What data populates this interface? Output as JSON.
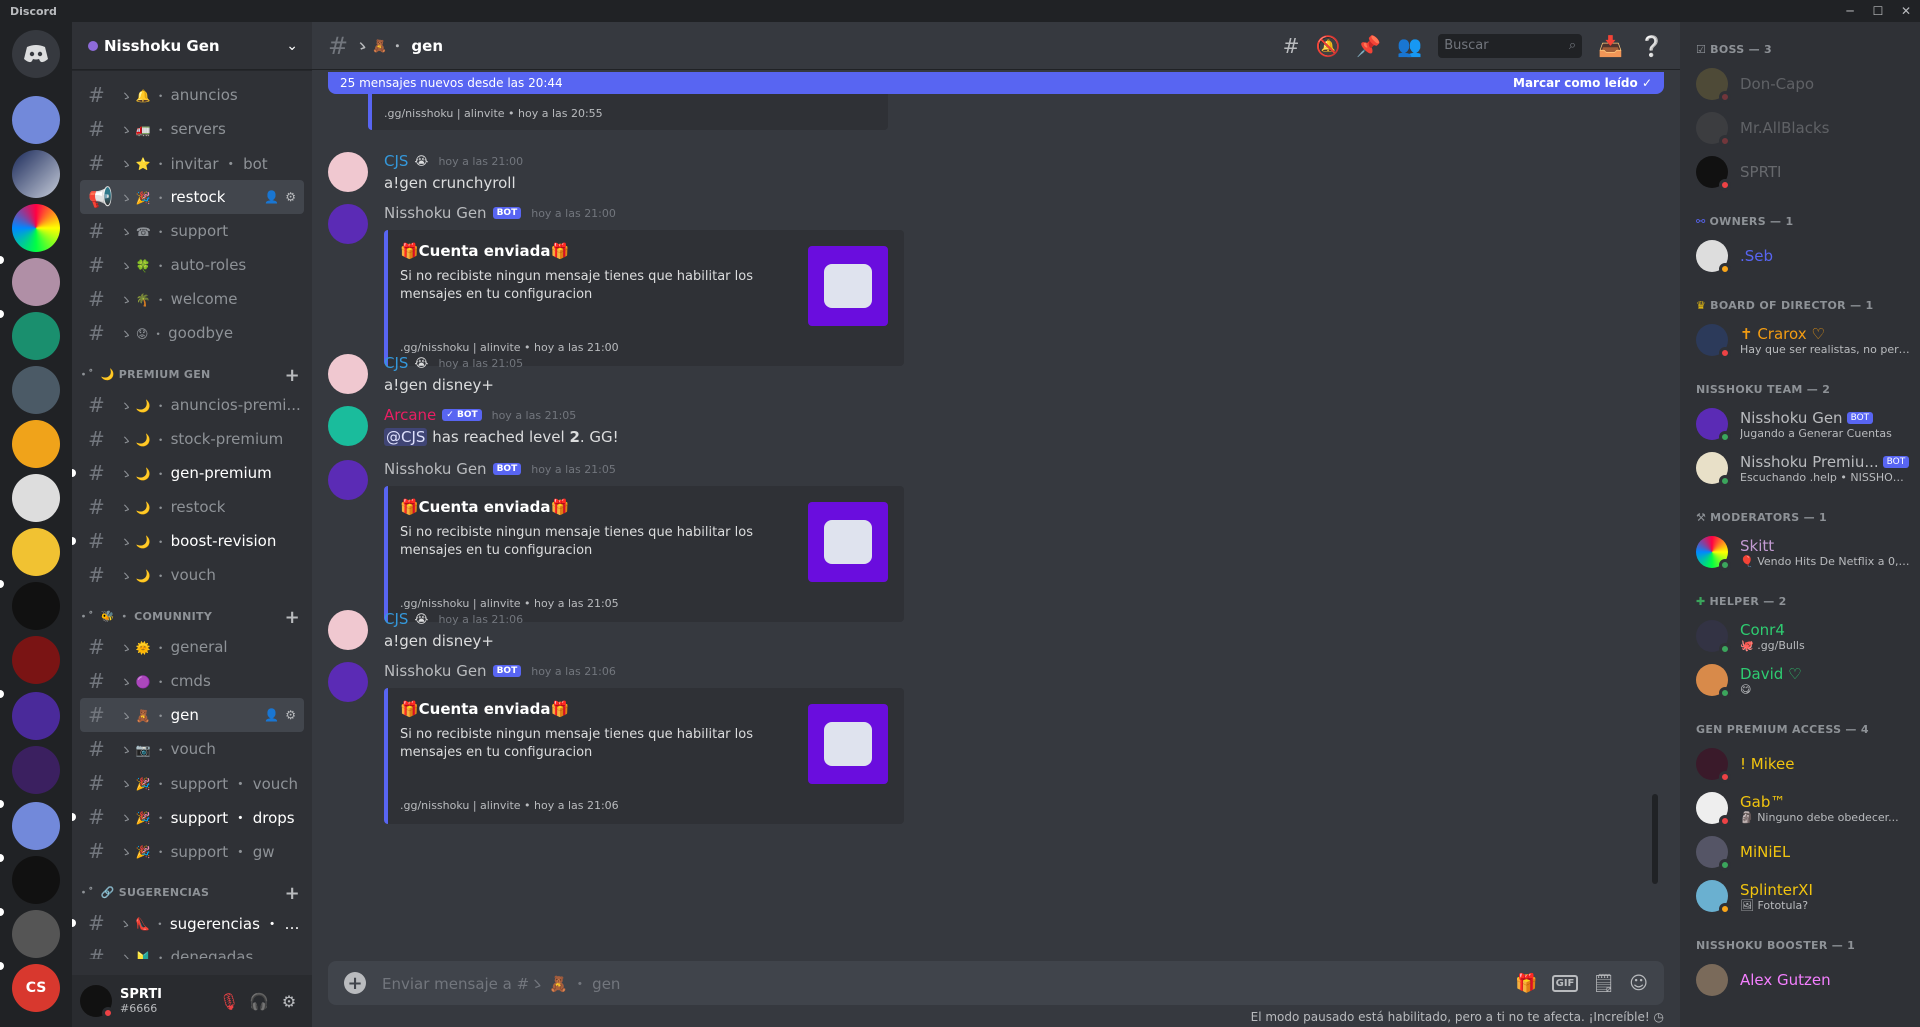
{
  "window": {
    "app_name": "Discord"
  },
  "server": {
    "name": "Nisshoku Gen"
  },
  "channels": [
    {
      "prefix": "ゝ 🔔 ・",
      "name": "anuncios"
    },
    {
      "prefix": "ゝ 🚛 ・",
      "name": "servers"
    },
    {
      "prefix": "ゝ ⭐ ・",
      "name": "invitar ・ bot"
    },
    {
      "prefix": "ゝ 🎉 ・",
      "name": "restock"
    },
    {
      "prefix": "ゝ ☎ ・",
      "name": "support"
    },
    {
      "prefix": "ゝ 🍀 ・",
      "name": "auto-roles"
    },
    {
      "prefix": "ゝ 🌴 ・",
      "name": "welcome"
    },
    {
      "prefix": "ゝ 😟 ・",
      "name": "goodbye"
    }
  ],
  "category_premium": {
    "label": "・゜🌙 PREMIUM GEN"
  },
  "channels_premium": [
    {
      "prefix": "ゝ 🌙 ・",
      "name": "anuncios-premi..."
    },
    {
      "prefix": "ゝ 🌙 ・",
      "name": "stock-premium"
    },
    {
      "prefix": "ゝ 🌙 ・",
      "name": "gen-premium"
    },
    {
      "prefix": "ゝ 🌙 ・",
      "name": "restock"
    },
    {
      "prefix": "ゝ 🌙 ・",
      "name": "boost-revision"
    },
    {
      "prefix": "ゝ 🌙 ・",
      "name": "vouch"
    }
  ],
  "category_community": {
    "label": "・゜🐝 ・ COMUNNITY"
  },
  "channels_community": [
    {
      "prefix": "ゝ 🌞 ・",
      "name": "general"
    },
    {
      "prefix": "ゝ 🟣 ・",
      "name": "cmds"
    },
    {
      "prefix": "ゝ 🧸 ・",
      "name": "gen"
    },
    {
      "prefix": "ゝ 📷 ・",
      "name": "vouch"
    },
    {
      "prefix": "ゝ 🎉 ・",
      "name": "support ・ vouch"
    },
    {
      "prefix": "ゝ 🎉 ・",
      "name": "support ・ drops"
    },
    {
      "prefix": "ゝ 🎉 ・",
      "name": "support ・ gw"
    }
  ],
  "category_sugerencias": {
    "label": "・゜🔗 SUGERENCIAS"
  },
  "channels_sugerencias": [
    {
      "prefix": "ゝ 👠 ・",
      "name": "sugerencias ・ b..."
    },
    {
      "prefix": "ゝ 🔰 ・",
      "name": "denegadas"
    }
  ],
  "user": {
    "name": "SPRTI",
    "tag": "#6666"
  },
  "chat": {
    "channel_prefix": "ゝ 🧸 ・",
    "channel_name": "gen",
    "search_placeholder": "Buscar",
    "new_messages": "25 mensajes nuevos desde las 20:44",
    "mark_read": "Marcar como leído",
    "composer_placeholder": "Enviar mensaje a #ゝ 🧸 ・ gen",
    "gif_label": "GIF",
    "pause_notice": "El modo pausado está habilitado, pero a ti no te afecta. ¡Increíble!"
  },
  "prev_embed_footer": ".gg/nisshoku | alinvite • hoy a las 20:55",
  "messages": [
    {
      "author": "CJS",
      "time": "hoy a las 21:00",
      "text": "a!gen crunchyroll"
    },
    {
      "author": "Nisshoku Gen",
      "badge": "BOT",
      "time": "hoy a las 21:00",
      "embed_title": "🎁Cuenta enviada🎁",
      "embed_desc": "Si no recibiste ningun mensaje tienes que habilitar los mensajes en tu configuracion",
      "embed_footer": ".gg/nisshoku | alinvite • hoy a las 21:00"
    },
    {
      "author": "CJS",
      "time": "hoy a las 21:05",
      "text": "a!gen disney+"
    },
    {
      "author": "Arcane",
      "badge": "✓ BOT",
      "time": "hoy a las 21:05",
      "mention": "@CJS",
      "text_after": " has reached level ",
      "level": "2",
      "text_end": ". GG!"
    },
    {
      "author": "Nisshoku Gen",
      "badge": "BOT",
      "time": "hoy a las 21:05",
      "embed_title": "🎁Cuenta enviada🎁",
      "embed_desc": "Si no recibiste ningun mensaje tienes que habilitar los mensajes en tu configuracion",
      "embed_footer": ".gg/nisshoku | alinvite • hoy a las 21:05"
    },
    {
      "author": "CJS",
      "time": "hoy a las 21:06",
      "text": "a!gen disney+"
    },
    {
      "author": "Nisshoku Gen",
      "badge": "BOT",
      "time": "hoy a las 21:06",
      "embed_title": "🎁Cuenta enviada🎁",
      "embed_desc": "Si no recibiste ningun mensaje tienes que habilitar los mensajes en tu configuracion",
      "embed_footer": ".gg/nisshoku | alinvite • hoy a las 21:06"
    }
  ],
  "member_groups": [
    {
      "label": "BOSS — 3",
      "members": [
        {
          "name": "Don-Capo"
        },
        {
          "name": "Mr.AllBlacks"
        },
        {
          "name": "SPRTI"
        }
      ]
    },
    {
      "label": "OWNERS — 1",
      "members": [
        {
          "name": ".Seb"
        }
      ]
    },
    {
      "label": "BOARD OF DIRECTOR — 1",
      "members": [
        {
          "name": "✝ Crarox ♡",
          "activity": "Hay que ser realistas, no perfe..."
        }
      ]
    },
    {
      "label": "NISSHOKU TEAM — 2",
      "members": [
        {
          "name": "Nisshoku Gen",
          "badge": "BOT",
          "activity": "Jugando a Generar Cuentas"
        },
        {
          "name": "Nisshoku Premiu...",
          "badge": "BOT",
          "activity": "Escuchando .help • NISSHOKU..."
        }
      ]
    },
    {
      "label": "MODERATORS — 1",
      "members": [
        {
          "name": "Skitt",
          "activity": "🎈 Vendo Hits De Netflix a 0,3..."
        }
      ]
    },
    {
      "label": "HELPER — 2",
      "members": [
        {
          "name": "Conr4",
          "activity": "🐙 .gg/Bulls"
        },
        {
          "name": "David ♡",
          "activity": "😋"
        }
      ]
    },
    {
      "label": "GEN PREMIUM ACCESS — 4",
      "members": [
        {
          "name": "! Mikee"
        },
        {
          "name": "Gab™",
          "activity": "🗿 Ninguno debe obedecer..."
        },
        {
          "name": "MiNiEL"
        },
        {
          "name": "SplinterXI",
          "activity": "🖼 Fototula?"
        }
      ]
    },
    {
      "label": "NISSHOKU BOOSTER — 1",
      "members": [
        {
          "name": "Alex Gutzen"
        }
      ]
    }
  ],
  "colors": {
    "accent": "#5865f2",
    "online": "#3ba55c",
    "dnd": "#ed4245",
    "idle": "#faa61a"
  }
}
